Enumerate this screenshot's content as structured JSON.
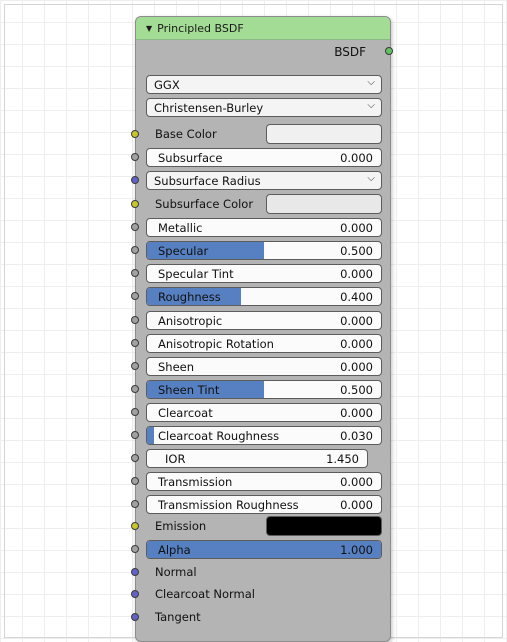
{
  "node": {
    "title": "Principled BSDF",
    "output_label": "BSDF",
    "distribution": "GGX",
    "subsurface_method": "Christensen-Burley",
    "base_color": {
      "label": "Base Color",
      "color": "#f0f0f0"
    },
    "subsurface": {
      "label": "Subsurface",
      "value": "0.000",
      "fraction": 0.0
    },
    "subsurface_radius": {
      "label": "Subsurface Radius"
    },
    "subsurface_color": {
      "label": "Subsurface Color",
      "color": "#e8e8e8"
    },
    "metallic": {
      "label": "Metallic",
      "value": "0.000",
      "fraction": 0.0
    },
    "specular": {
      "label": "Specular",
      "value": "0.500",
      "fraction": 0.5
    },
    "specular_tint": {
      "label": "Specular Tint",
      "value": "0.000",
      "fraction": 0.0
    },
    "roughness": {
      "label": "Roughness",
      "value": "0.400",
      "fraction": 0.4
    },
    "anisotropic": {
      "label": "Anisotropic",
      "value": "0.000",
      "fraction": 0.0
    },
    "anisotropic_rotation": {
      "label": "Anisotropic Rotation",
      "value": "0.000",
      "fraction": 0.0
    },
    "sheen": {
      "label": "Sheen",
      "value": "0.000",
      "fraction": 0.0
    },
    "sheen_tint": {
      "label": "Sheen Tint",
      "value": "0.500",
      "fraction": 0.5
    },
    "clearcoat": {
      "label": "Clearcoat",
      "value": "0.000",
      "fraction": 0.0
    },
    "clearcoat_roughness": {
      "label": "Clearcoat Roughness",
      "value": "0.030",
      "fraction": 0.03
    },
    "ior": {
      "label": "IOR",
      "value": "1.450"
    },
    "transmission": {
      "label": "Transmission",
      "value": "0.000",
      "fraction": 0.0
    },
    "transmission_roughness": {
      "label": "Transmission Roughness",
      "value": "0.000",
      "fraction": 0.0
    },
    "emission": {
      "label": "Emission",
      "color": "#000000"
    },
    "alpha": {
      "label": "Alpha",
      "value": "1.000",
      "fraction": 1.0
    },
    "normal": {
      "label": "Normal"
    },
    "clearcoat_normal": {
      "label": "Clearcoat Normal"
    },
    "tangent": {
      "label": "Tangent"
    }
  },
  "colors": {
    "header": "#a3dc95",
    "node_body": "#b4b4b4",
    "slider_fill": "#5680c2",
    "socket_color": "#c7c72a",
    "socket_float": "#a1a1a1",
    "socket_vector": "#6363c7",
    "socket_shader": "#5fc35f"
  },
  "icons": {
    "collapse": "triangle-down-icon",
    "dropdown": "chevron-down-icon"
  }
}
